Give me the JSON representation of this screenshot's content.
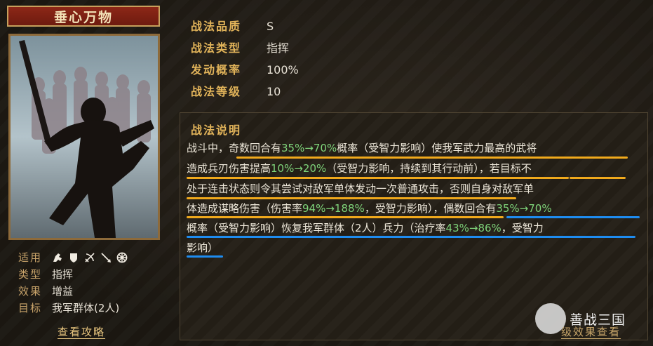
{
  "skill": {
    "name": "垂心万物"
  },
  "info": {
    "applicable_label": "适用",
    "applicable_icons": [
      "cavalry-icon",
      "shield-icon",
      "bow-icon",
      "spear-icon",
      "wheel-icon"
    ],
    "type_label": "类型",
    "type_value": "指挥",
    "effect_label": "效果",
    "effect_value": "增益",
    "target_label": "目标",
    "target_value": "我军群体(2人)",
    "strategy_link": "查看攻略"
  },
  "stats": [
    {
      "key": "战法品质",
      "value": "S"
    },
    {
      "key": "战法类型",
      "value": "指挥"
    },
    {
      "key": "发动概率",
      "value": "100%"
    },
    {
      "key": "战法等级",
      "value": "10"
    }
  ],
  "description": {
    "title": "战法说明",
    "lines": [
      [
        {
          "t": "战斗中，奇数回合有"
        },
        {
          "t": "35%→70%",
          "g": true
        },
        {
          "t": "概率（受智力影响）使我军武力最高的武将"
        }
      ],
      [
        {
          "t": "造成兵刃伤害提高"
        },
        {
          "t": "10%→20%",
          "g": true
        },
        {
          "t": "（受智力影响，持续到其行动前），若目标不"
        }
      ],
      [
        {
          "t": "处于连击状态则令其尝试对敌军单体发动一次普通攻击，否则自身对敌军单"
        }
      ],
      [
        {
          "t": "体造成谋略伤害（伤害率"
        },
        {
          "t": "94%→188%",
          "g": true
        },
        {
          "t": "，受智力影响），偶数回合有"
        },
        {
          "t": "35%→70%",
          "g": true
        }
      ],
      [
        {
          "t": "概率（受智力影响）恢复我军群体（2人）兵力（治疗率"
        },
        {
          "t": "43%→86%",
          "g": true
        },
        {
          "t": "，受智力"
        }
      ],
      [
        {
          "t": "影响）"
        }
      ]
    ]
  },
  "level_link": "级效果查看",
  "watermark": "善战三国",
  "colors": {
    "gold": "#e2b45a",
    "green": "#7fd47a",
    "underline_yellow": "#f0a91c",
    "underline_blue": "#1e8cf0",
    "banner": "#8c2717"
  }
}
